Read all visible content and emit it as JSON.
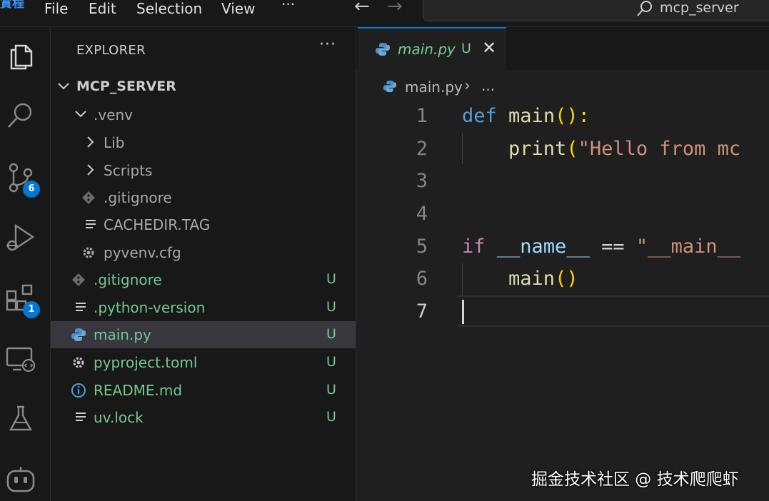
{
  "titlebar": {
    "logo_text": "賞程",
    "menu": [
      "File",
      "Edit",
      "Selection",
      "View",
      "···"
    ],
    "search_text": "mcp_server"
  },
  "activity_bar": {
    "source_control_badge": "6",
    "extensions_badge": "1"
  },
  "sidebar": {
    "title": "EXPLORER",
    "more": "···",
    "root": "MCP_SERVER",
    "items": [
      {
        "label": ".venv",
        "icon": "chevron-down",
        "depth": 1,
        "status": ""
      },
      {
        "label": "Lib",
        "icon": "chevron-right",
        "depth": 2,
        "status": ""
      },
      {
        "label": "Scripts",
        "icon": "chevron-right",
        "depth": 2,
        "status": ""
      },
      {
        "label": ".gitignore",
        "icon": "git-icon",
        "depth": 2,
        "status": ""
      },
      {
        "label": "CACHEDIR.TAG",
        "icon": "lines-icon",
        "depth": 2,
        "status": ""
      },
      {
        "label": "pyvenv.cfg",
        "icon": "gear-icon",
        "depth": 2,
        "status": ""
      },
      {
        "label": ".gitignore",
        "icon": "git-icon",
        "depth": 1,
        "status": "U"
      },
      {
        "label": ".python-version",
        "icon": "lines-icon",
        "depth": 1,
        "status": "U"
      },
      {
        "label": "main.py",
        "icon": "python-icon",
        "depth": 1,
        "status": "U"
      },
      {
        "label": "pyproject.toml",
        "icon": "gear-icon",
        "depth": 1,
        "status": "U"
      },
      {
        "label": "README.md",
        "icon": "info-icon",
        "depth": 1,
        "status": "U"
      },
      {
        "label": "uv.lock",
        "icon": "lines-icon",
        "depth": 1,
        "status": "U"
      }
    ]
  },
  "editor": {
    "tab": {
      "label": "main.py",
      "status": "U",
      "close": "✕"
    },
    "breadcrumb": {
      "file": "main.py",
      "separator": "›",
      "more": "..."
    },
    "line_numbers": [
      "1",
      "2",
      "3",
      "4",
      "5",
      "6",
      "7"
    ],
    "code": {
      "l1_kw": "def",
      "l1_fn": "main",
      "l1_punc": "():",
      "l2_fn": "print",
      "l2_paren": "(",
      "l2_str": "\"Hello from mc",
      "l5_kw": "if",
      "l5_var": "__name__",
      "l5_op": "==",
      "l5_str": "\"__main__",
      "l6_fn": "main",
      "l6_punc": "()"
    }
  },
  "watermark": "掘金技术社区 @ 技术爬爬虾"
}
